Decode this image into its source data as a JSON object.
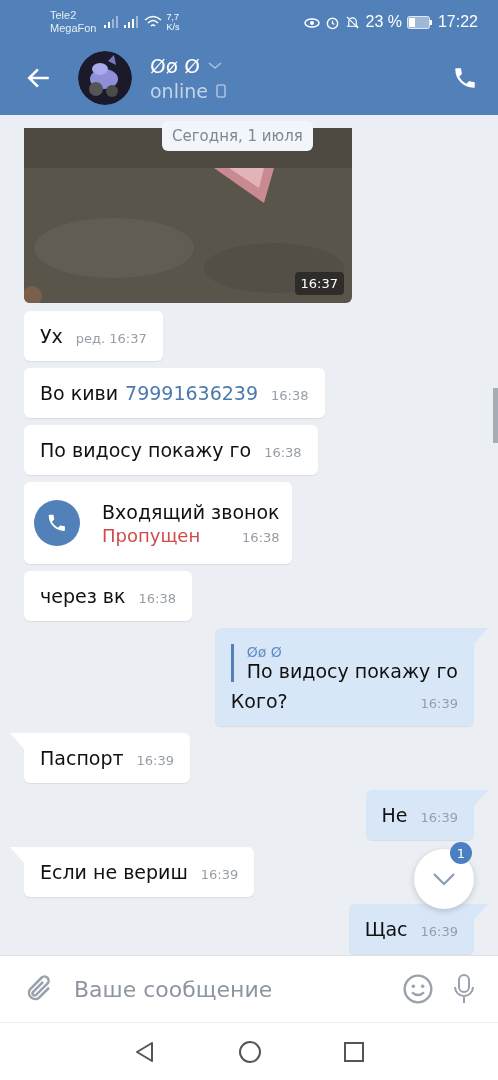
{
  "status_bar": {
    "carriers": [
      "Tele2",
      "MegaFon"
    ],
    "speed": "7,7",
    "speed_unit": "K/s",
    "battery_text": "23 %",
    "time": "17:22"
  },
  "header": {
    "name": "Øø Ø",
    "status": "online"
  },
  "date_pill": "Сегодня, 1 июля",
  "photo": {
    "kind": "picture",
    "time": "16:37"
  },
  "messages": [
    {
      "kind": "text",
      "outgoing": false,
      "tail": false,
      "text": "Ух",
      "time": "ред. 16:37"
    },
    {
      "kind": "text",
      "outgoing": false,
      "tail": false,
      "text": "Во киви",
      "link": "79991636239",
      "time": "16:38"
    },
    {
      "kind": "text",
      "outgoing": false,
      "tail": false,
      "text": "По видосу покажу го",
      "time": "16:38"
    },
    {
      "kind": "call",
      "outgoing": false,
      "tail": false,
      "title": "Входящий звонок",
      "status": "Пропущен",
      "time": "16:38"
    },
    {
      "kind": "text",
      "outgoing": false,
      "tail": false,
      "text": "через вк",
      "time": "16:38"
    },
    {
      "kind": "reply",
      "outgoing": true,
      "tail": true,
      "quote_author": "Øø Ø",
      "quote_text": "По видосу покажу го",
      "text": "Кого?",
      "time": "16:39"
    },
    {
      "kind": "text",
      "outgoing": false,
      "tail": true,
      "text": "Паспорт",
      "time": "16:39"
    },
    {
      "kind": "text",
      "outgoing": true,
      "tail": true,
      "text": "Не",
      "time": "16:39"
    },
    {
      "kind": "text",
      "outgoing": false,
      "tail": true,
      "text": "Если не вериш",
      "time": "16:39"
    },
    {
      "kind": "text",
      "outgoing": true,
      "tail": true,
      "text": "Щас",
      "time": "16:39"
    }
  ],
  "scroll_button": {
    "badge": "1"
  },
  "composer": {
    "placeholder": "Ваше сообщение"
  }
}
